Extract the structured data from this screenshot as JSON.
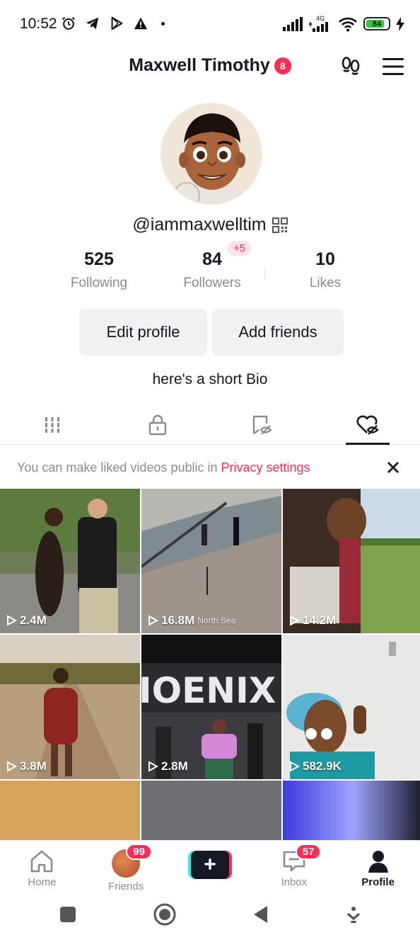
{
  "status_bar": {
    "time": "10:52",
    "network": "4G",
    "battery": "84",
    "icons_left": [
      "alarm-icon",
      "telegram-icon",
      "play-store-icon",
      "warning-icon"
    ],
    "icons_right": [
      "signal-icon",
      "signal-4g-icon",
      "wifi-icon",
      "battery-icon",
      "charging-icon"
    ]
  },
  "header": {
    "display_name": "Maxwell Timothy",
    "notification_badge": "8",
    "icons": [
      "footprints-icon",
      "menu-icon"
    ]
  },
  "profile": {
    "handle": "@iammaxwelltim",
    "bio": "here's a short Bio",
    "stats": [
      {
        "value": "525",
        "label": "Following"
      },
      {
        "value": "84",
        "label": "Followers",
        "delta": "+5"
      },
      {
        "value": "10",
        "label": "Likes"
      }
    ],
    "buttons": {
      "edit": "Edit profile",
      "add": "Add friends"
    }
  },
  "tabs": [
    {
      "icon": "videos-grid-icon",
      "active": false
    },
    {
      "icon": "lock-icon",
      "active": false
    },
    {
      "icon": "bookmark-hidden-icon",
      "active": false
    },
    {
      "icon": "liked-hidden-icon",
      "active": true
    }
  ],
  "notice": {
    "text": "You can make liked videos public in",
    "link": "Privacy settings"
  },
  "videos": [
    {
      "views": "2.4M"
    },
    {
      "views": "16.8M",
      "caption": "North Sea"
    },
    {
      "views": "14.2M"
    },
    {
      "views": "3.8M"
    },
    {
      "views": "2.8M",
      "caption": "IOENIX"
    },
    {
      "views": "582.9K"
    }
  ],
  "bottom_nav": {
    "home": "Home",
    "friends": "Friends",
    "friends_badge": "99",
    "create": "+",
    "inbox": "Inbox",
    "inbox_badge": "57",
    "profile": "Profile"
  },
  "colors": {
    "accent": "#fe2c55",
    "text": "#161823",
    "muted": "#8a8b91",
    "button_bg": "#f1f1f2"
  }
}
